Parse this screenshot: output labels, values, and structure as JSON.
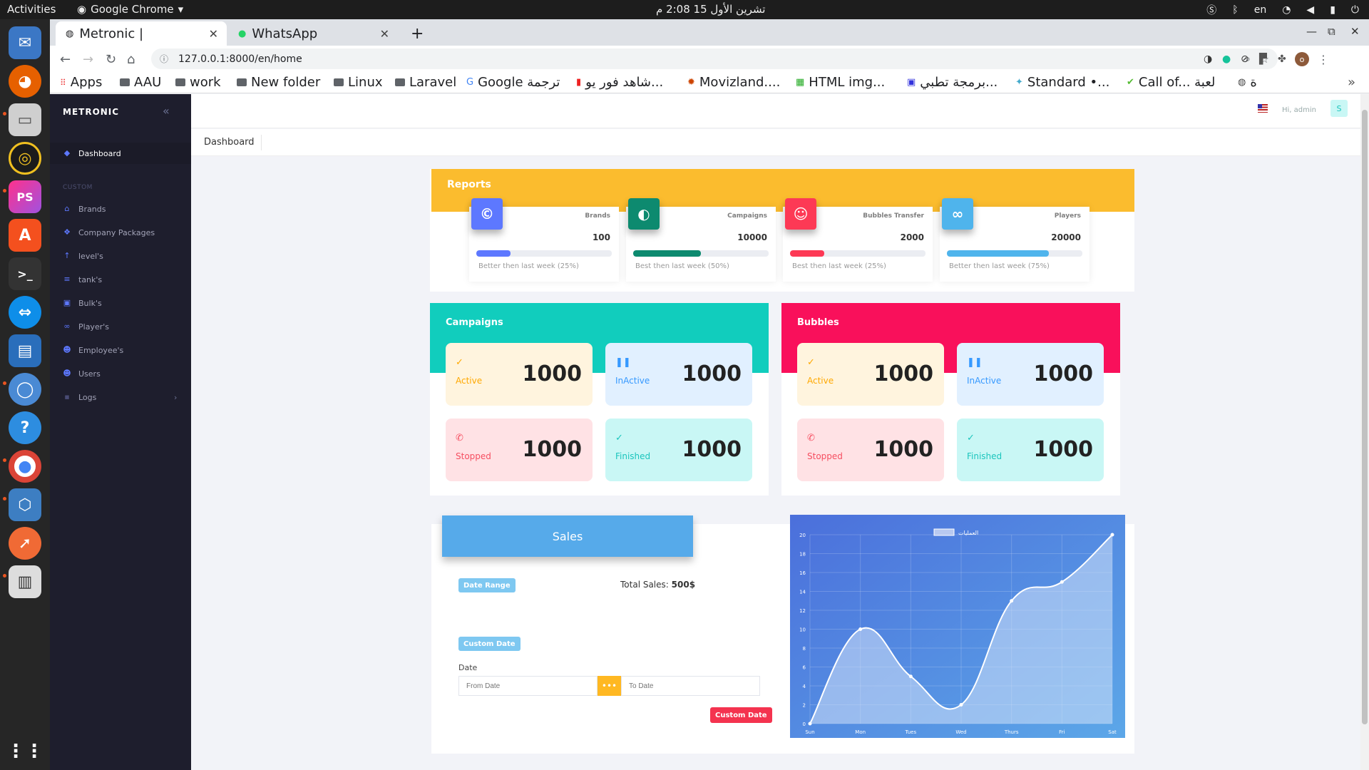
{
  "system": {
    "activities": "Activities",
    "app_name": "Google Chrome",
    "clock": "تشرين الأول 15  2:08 م",
    "lang": "en"
  },
  "browser": {
    "tabs": [
      {
        "label": "Metronic |"
      },
      {
        "label": "WhatsApp"
      }
    ],
    "url": "127.0.0.1:8000/en/home",
    "bookmarks": [
      "Apps",
      "AAU",
      "work",
      "New folder",
      "Linux",
      "Laravel",
      "Google ترجمة",
      "شاهد فور يو...",
      "Movizland....",
      "HTML img...",
      "برمجة تطبي...",
      "Standard •...",
      "Call of... لعبة",
      "ة"
    ]
  },
  "sidebar": {
    "brand": "METRONIC",
    "section_label": "CUSTOM",
    "items": [
      {
        "label": "Dashboard",
        "icon": "diamond-icon"
      },
      {
        "label": "Brands",
        "icon": "bank-icon"
      },
      {
        "label": "Company Packages",
        "icon": "cubes-icon"
      },
      {
        "label": "level's",
        "icon": "arrow-up-icon"
      },
      {
        "label": "tank's",
        "icon": "database-icon"
      },
      {
        "label": "Bulk's",
        "icon": "box-icon"
      },
      {
        "label": "Player's",
        "icon": "bicycle-icon"
      },
      {
        "label": "Employee's",
        "icon": "users-icon"
      },
      {
        "label": "Users",
        "icon": "user-group-icon"
      },
      {
        "label": "Logs",
        "icon": "grid-icon"
      }
    ]
  },
  "header": {
    "greeting": "Hi, admin",
    "avatar_letter": "S"
  },
  "subheader": {
    "title": "Dashboard"
  },
  "reports": {
    "title": "Reports",
    "cards": [
      {
        "label": "Brands",
        "value": "100",
        "note": "Better then last week (25%)",
        "progress": 0.25,
        "color": "#5d78ff",
        "icon": "copyright-icon",
        "glyph": "©"
      },
      {
        "label": "Campaigns",
        "value": "10000",
        "note": "Best then last week (50%)",
        "progress": 0.5,
        "color": "#0d8a6f",
        "icon": "volleyball-icon",
        "glyph": "◐"
      },
      {
        "label": "Bubbles Transfer",
        "value": "2000",
        "note": "Best then last week (25%)",
        "progress": 0.25,
        "color": "#fd3955",
        "icon": "robot-icon",
        "glyph": "☺"
      },
      {
        "label": "Players",
        "value": "20000",
        "note": "Better then last week (75%)",
        "progress": 0.75,
        "color": "#4fb4ec",
        "icon": "bicycle-icon",
        "glyph": "∞"
      }
    ]
  },
  "campaigns": {
    "title": "Campaigns",
    "tiles": [
      {
        "label": "Active",
        "value": "1000"
      },
      {
        "label": "InActive",
        "value": "1000"
      },
      {
        "label": "Stopped",
        "value": "1000"
      },
      {
        "label": "Finished",
        "value": "1000"
      }
    ]
  },
  "bubbles": {
    "title": "Bubbles",
    "tiles": [
      {
        "label": "Active",
        "value": "1000"
      },
      {
        "label": "InActive",
        "value": "1000"
      },
      {
        "label": "Stopped",
        "value": "1000"
      },
      {
        "label": "Finished",
        "value": "1000"
      }
    ]
  },
  "sales": {
    "title": "Sales",
    "date_range": "Date Range",
    "total_label": "Total Sales:",
    "total_value": "500$",
    "custom_date": "Custom Date",
    "date_label": "Date",
    "from_placeholder": "From Date",
    "to_placeholder": "To Date",
    "submit": "Custom Date"
  },
  "chart_data": {
    "type": "line",
    "title": "",
    "legend": "العمليات",
    "legend_position": "top",
    "categories": [
      "Sun",
      "Mon",
      "Tues",
      "Wed",
      "Thurs",
      "Fri",
      "Sat"
    ],
    "series": [
      {
        "name": "العمليات",
        "values": [
          0,
          10,
          5,
          2,
          13,
          15,
          20
        ]
      }
    ],
    "ylim": [
      0,
      20
    ],
    "yticks": [
      0,
      2,
      4,
      6,
      8,
      10,
      12,
      14,
      16,
      18,
      20
    ],
    "grid": true
  }
}
